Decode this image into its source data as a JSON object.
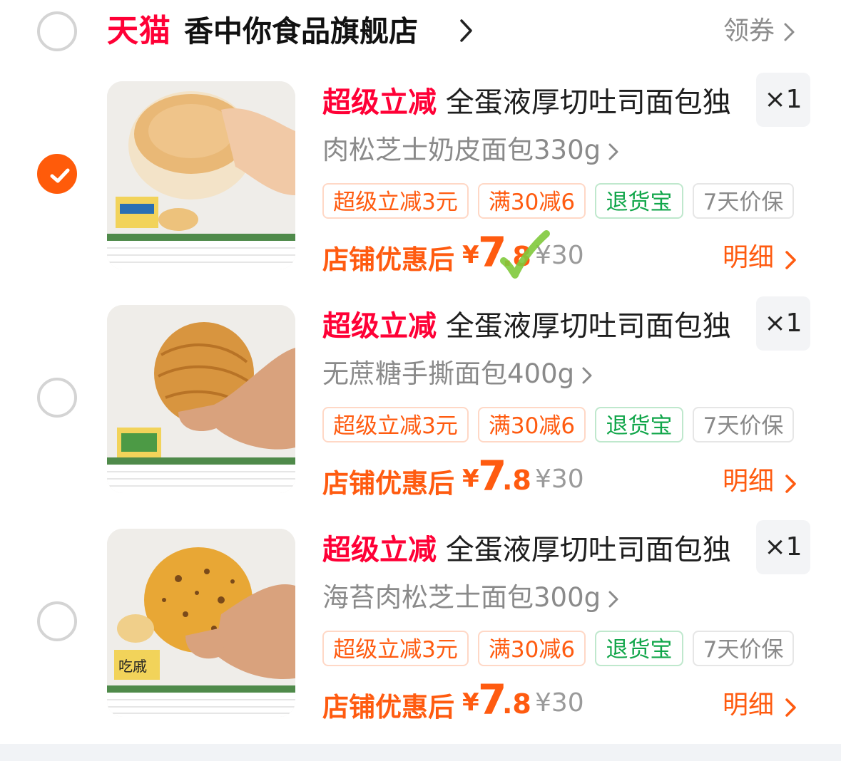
{
  "store": {
    "brand_label": "天猫",
    "name": "香中你食品旗舰店",
    "coupon_label": "领券"
  },
  "items": [
    {
      "checked": true,
      "promo": "超级立减",
      "title": "全蛋液厚切吐司面包独",
      "quantity": "×1",
      "sku": "肉松芝士奶皮面包330g",
      "tags": [
        "超级立减3元",
        "满30减6",
        "退货宝",
        "7天价保"
      ],
      "price_label": "店铺优惠后",
      "price_currency": "¥",
      "price_int": "7",
      "price_dec": ".8",
      "original_price": "¥30",
      "detail_label": "明细",
      "image": "round-milk-bread"
    },
    {
      "checked": false,
      "promo": "超级立减",
      "title": "全蛋液厚切吐司面包独",
      "quantity": "×1",
      "sku": "无蔗糖手撕面包400g",
      "tags": [
        "超级立减3元",
        "满30减6",
        "退货宝",
        "7天价保"
      ],
      "price_label": "店铺优惠后",
      "price_currency": "¥",
      "price_int": "7",
      "price_dec": ".8",
      "original_price": "¥30",
      "detail_label": "明细",
      "image": "hand-torn-bread"
    },
    {
      "checked": false,
      "promo": "超级立减",
      "title": "全蛋液厚切吐司面包独",
      "quantity": "×1",
      "sku": "海苔肉松芝士面包300g",
      "tags": [
        "超级立减3元",
        "满30减6",
        "退货宝",
        "7天价保"
      ],
      "price_label": "店铺优惠后",
      "price_currency": "¥",
      "price_int": "7",
      "price_dec": ".8",
      "original_price": "¥30",
      "detail_label": "明细",
      "image": "pork-floss-cheese-bread"
    }
  ],
  "colors": {
    "tmall_red": "#ff0036",
    "accent_orange": "#ff5b10",
    "check_orange": "#ff5b0a",
    "green": "#11a64a"
  }
}
